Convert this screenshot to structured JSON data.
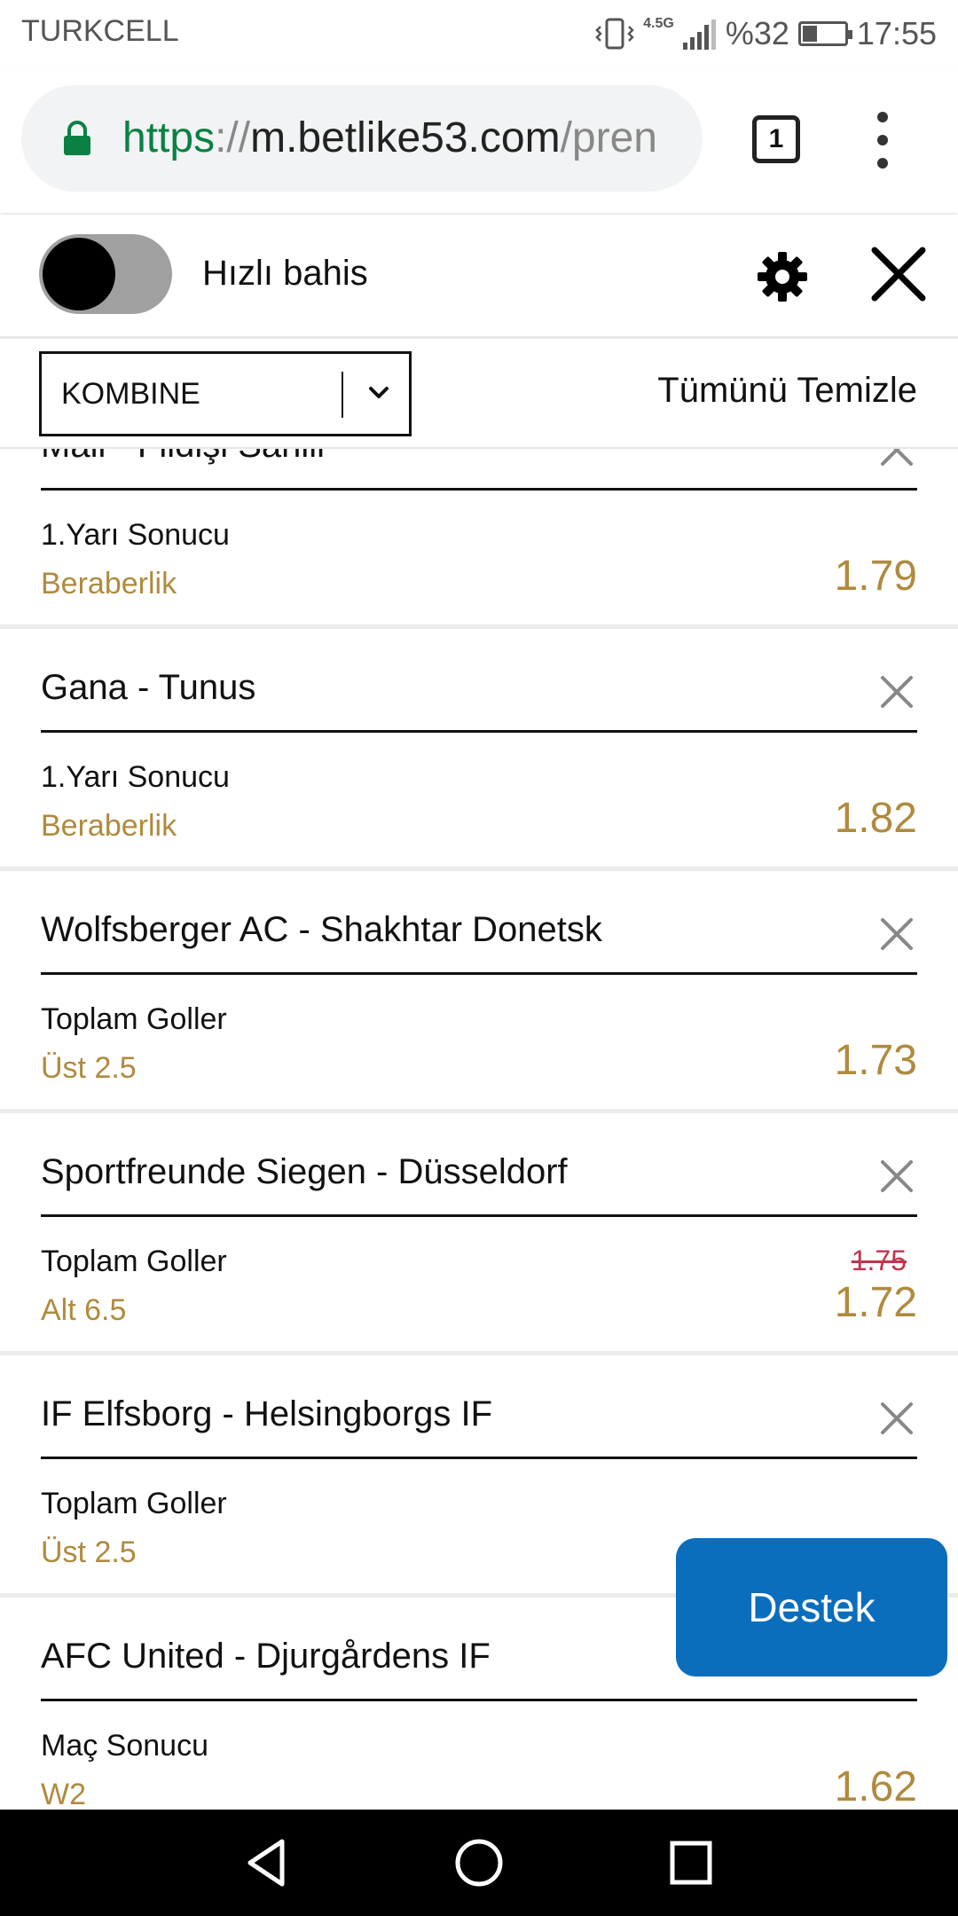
{
  "status_bar": {
    "carrier": "TURKCELL",
    "network": "4.5G",
    "battery": "%32",
    "time": "17:55"
  },
  "browser": {
    "url_scheme": "https",
    "url_sep": "://",
    "url_host": "m.betlike53.com",
    "url_path": "/pren",
    "tab_count": "1"
  },
  "header": {
    "quick_bet_label": "Hızlı bahis",
    "quick_bet_on": false
  },
  "controls": {
    "bet_type": "KOMBINE",
    "clear_all": "Tümünü Temizle"
  },
  "bets": [
    {
      "match": "Mali - Fildişi Sahili",
      "market": "1.Yarı Sonucu",
      "selection": "Beraberlik",
      "odds": "1.79",
      "old_odds": ""
    },
    {
      "match": "Gana - Tunus",
      "market": "1.Yarı Sonucu",
      "selection": "Beraberlik",
      "odds": "1.82",
      "old_odds": ""
    },
    {
      "match": "Wolfsberger AC - Shakhtar Donetsk",
      "market": "Toplam Goller",
      "selection": "Üst 2.5",
      "odds": "1.73",
      "old_odds": ""
    },
    {
      "match": "Sportfreunde Siegen - Düsseldorf",
      "market": "Toplam Goller",
      "selection": "Alt 6.5",
      "odds": "1.72",
      "old_odds": "1.75"
    },
    {
      "match": "IF Elfsborg - Helsingborgs IF",
      "market": "Toplam Goller",
      "selection": "Üst 2.5",
      "odds": "",
      "old_odds": ""
    },
    {
      "match": "AFC United - Djurgårdens IF",
      "market": "Maç Sonucu",
      "selection": "W2",
      "odds": "1.62",
      "old_odds": ""
    }
  ],
  "support_button": "Destek",
  "colors": {
    "accent_gold": "#b08a3e",
    "old_odds_red": "#c2334d",
    "support_blue": "#0a6ebd",
    "secure_green": "#0b8043"
  },
  "icons": {
    "lock": "lock-icon",
    "settings": "gear-icon",
    "close": "close-icon",
    "remove": "close-icon",
    "dropdown": "chevron-down-icon",
    "nav_back": "back-triangle-icon",
    "nav_home": "home-circle-icon",
    "nav_recents": "recents-square-icon"
  }
}
